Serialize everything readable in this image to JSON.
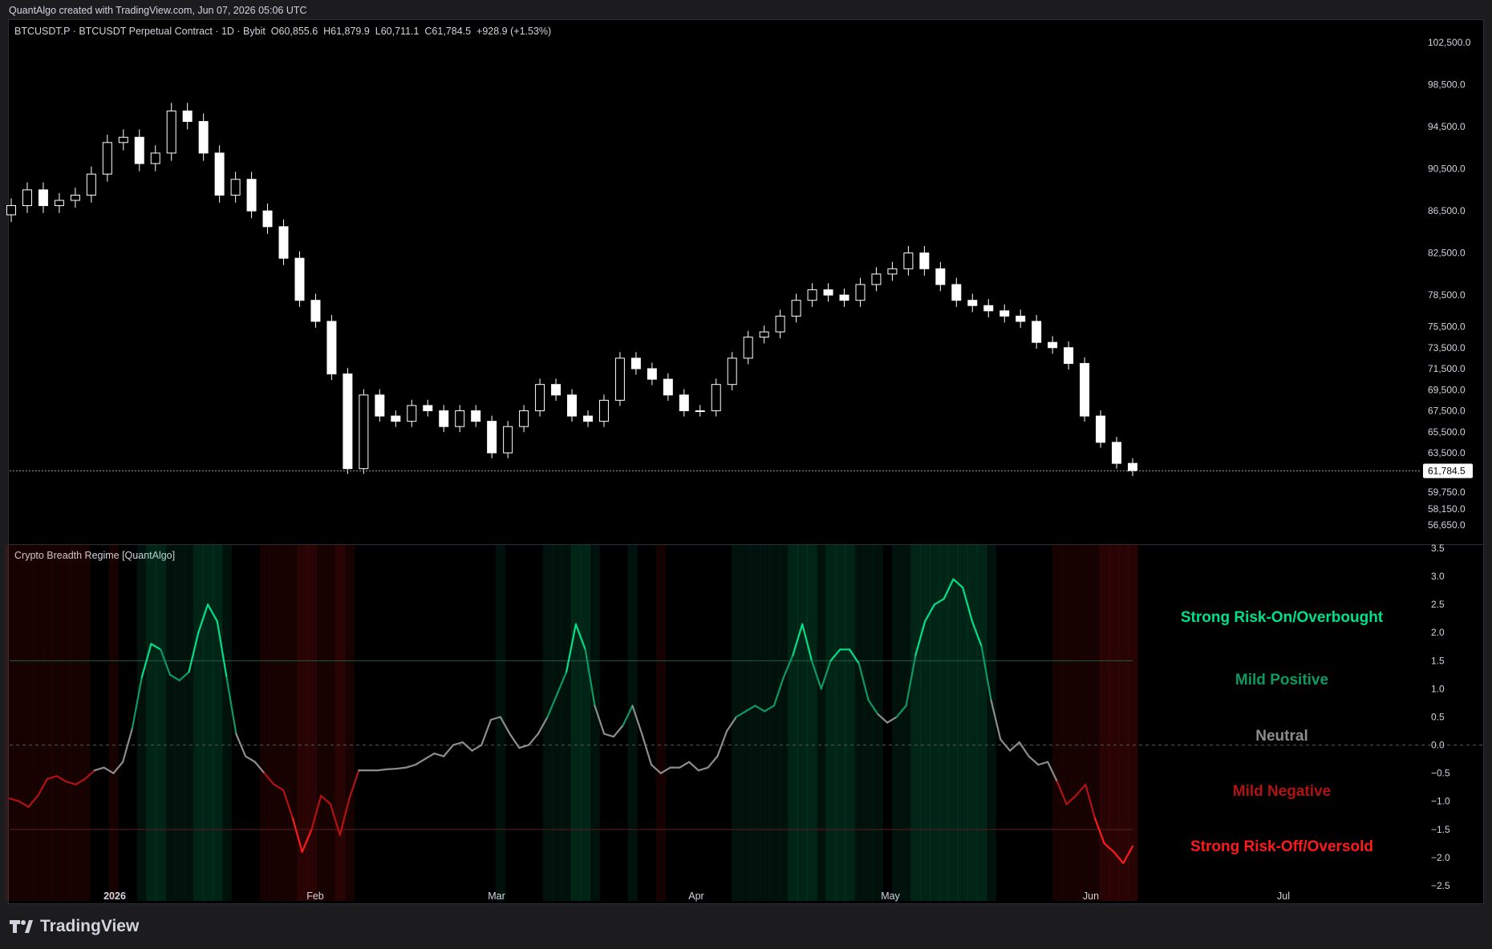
{
  "credit": "QuantAlgo created with TradingView.com, Jun 07, 2026 05:06 UTC",
  "symbol_legend": {
    "name": "BTCUSDT.P · BTCUSDT Perpetual Contract · 1D · Bybit",
    "open": "O60,855.6",
    "high": "H61,879.9",
    "low": "L60,711.1",
    "close": "C61,784.5",
    "change": "+928.9 (+1.53%)"
  },
  "indicator_title": "Crypto Breadth Regime [QuantAlgo]",
  "price_axis_ticks": [
    "102,500.0",
    "98,500.0",
    "94,500.0",
    "90,500.0",
    "86,500.0",
    "82,500.0",
    "78,500.0",
    "75,500.0",
    "73,500.0",
    "71,500.0",
    "69,500.0",
    "67,500.0",
    "65,500.0",
    "63,500.0",
    "59,750.0",
    "58,150.0",
    "56,650.0"
  ],
  "last_price": "61,784.5",
  "osc_axis_ticks": [
    "3.5",
    "3.0",
    "2.5",
    "2.0",
    "1.5",
    "1.0",
    "0.5",
    "0.0",
    "−0.5",
    "−1.0",
    "−1.5",
    "−2.0",
    "−2.5"
  ],
  "time_axis": [
    "2026",
    "Feb",
    "Mar",
    "Apr",
    "May",
    "Jun",
    "Jul"
  ],
  "regime_labels": [
    {
      "text": "Strong Risk-On/Overbought",
      "color": "#00e08a"
    },
    {
      "text": "Mild Positive",
      "color": "#0b9a63"
    },
    {
      "text": "Neutral",
      "color": "#8d8d8d"
    },
    {
      "text": "Mild Negative",
      "color": "#b31212"
    },
    {
      "text": "Strong Risk-Off/Oversold",
      "color": "#ff1a1a"
    }
  ],
  "colors": {
    "candle": "#ffffff",
    "strong_up": "#00e08a",
    "mild_up": "#0b9a63",
    "neutral": "#8d8d8d",
    "mild_down": "#b31212",
    "strong_down": "#ff1a1a"
  },
  "footer_brand": "TradingView",
  "chart_data": [
    {
      "type": "candlestick",
      "title": "BTCUSDT.P · BTCUSDT Perpetual Contract · 1D · Bybit",
      "ylim": [
        55500,
        103500
      ],
      "close_series_approx": [
        87000,
        88500,
        87000,
        87500,
        88000,
        90000,
        93000,
        93500,
        91000,
        92000,
        96000,
        95000,
        92000,
        88000,
        89500,
        86500,
        85000,
        82000,
        78000,
        76000,
        71000,
        62000,
        69000,
        67000,
        66500,
        68000,
        67500,
        66000,
        67500,
        66500,
        63500,
        66000,
        67500,
        70000,
        69000,
        67000,
        66500,
        68500,
        72500,
        71500,
        70500,
        69000,
        67500,
        67500,
        70000,
        72500,
        74500,
        75000,
        76500,
        78000,
        79000,
        78500,
        78000,
        79500,
        80500,
        81000,
        82500,
        81000,
        79500,
        78000,
        77500,
        77000,
        76500,
        76000,
        74000,
        73500,
        72000,
        67000,
        64500,
        62500,
        61784.5
      ],
      "last": 61784.5
    },
    {
      "type": "line",
      "title": "Crypto Breadth Regime [QuantAlgo]",
      "ylim": [
        -2.6,
        3.5
      ],
      "values": [
        -0.95,
        -1.0,
        -1.1,
        -0.9,
        -0.6,
        -0.55,
        -0.65,
        -0.7,
        -0.6,
        -0.45,
        -0.4,
        -0.5,
        -0.3,
        0.3,
        1.2,
        1.8,
        1.7,
        1.25,
        1.15,
        1.3,
        2.0,
        2.5,
        2.2,
        1.2,
        0.2,
        -0.2,
        -0.3,
        -0.5,
        -0.7,
        -0.8,
        -1.3,
        -1.9,
        -1.5,
        -0.9,
        -1.05,
        -1.6,
        -0.95,
        -0.45,
        -0.45,
        -0.45,
        -0.43,
        -0.42,
        -0.4,
        -0.35,
        -0.25,
        -0.15,
        -0.2,
        0.0,
        0.05,
        -0.1,
        0.0,
        0.45,
        0.5,
        0.2,
        -0.05,
        0.0,
        0.2,
        0.5,
        0.9,
        1.3,
        2.15,
        1.7,
        0.7,
        0.2,
        0.15,
        0.35,
        0.7,
        0.2,
        -0.35,
        -0.5,
        -0.4,
        -0.4,
        -0.3,
        -0.45,
        -0.4,
        -0.2,
        0.25,
        0.5,
        0.6,
        0.7,
        0.6,
        0.7,
        1.2,
        1.6,
        2.15,
        1.5,
        1.0,
        1.5,
        1.7,
        1.7,
        1.45,
        0.8,
        0.55,
        0.4,
        0.5,
        0.7,
        1.6,
        2.2,
        2.5,
        2.6,
        2.95,
        2.8,
        2.2,
        1.75,
        0.8,
        0.1,
        -0.1,
        0.05,
        -0.2,
        -0.35,
        -0.3,
        -0.65,
        -1.05,
        -0.9,
        -0.7,
        -1.3,
        -1.75,
        -1.9,
        -2.1,
        -1.8
      ]
    }
  ]
}
